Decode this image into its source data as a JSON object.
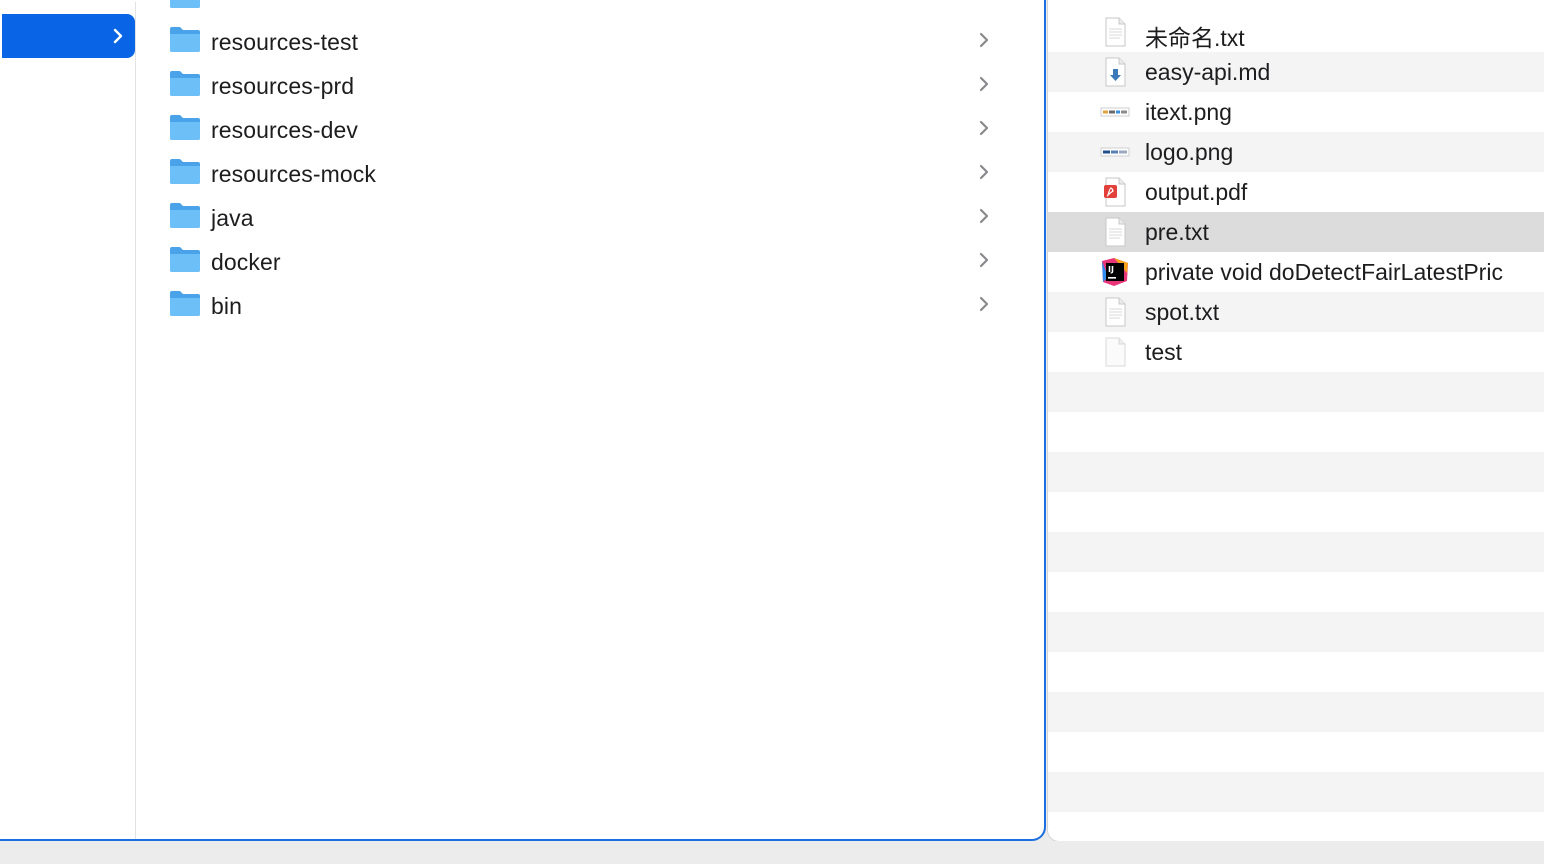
{
  "sidebar": {
    "selected_color": "#0a64e6"
  },
  "folders": [
    {
      "label": "resources-test"
    },
    {
      "label": "resources-prd"
    },
    {
      "label": "resources-dev"
    },
    {
      "label": "resources-mock"
    },
    {
      "label": "java"
    },
    {
      "label": "docker"
    },
    {
      "label": "bin"
    }
  ],
  "files": [
    {
      "name": "未命名.txt",
      "icon": "text-file-icon"
    },
    {
      "name": "easy-api.md",
      "icon": "markdown-file-icon"
    },
    {
      "name": "itext.png",
      "icon": "png-image-icon"
    },
    {
      "name": "logo.png",
      "icon": "png-image-icon"
    },
    {
      "name": "output.pdf",
      "icon": "pdf-file-icon"
    },
    {
      "name": "pre.txt",
      "icon": "text-file-icon",
      "selected": true
    },
    {
      "name": "private void doDetectFairLatestPric",
      "icon": "intellij-file-icon"
    },
    {
      "name": "spot.txt",
      "icon": "text-file-icon"
    },
    {
      "name": "test",
      "icon": "blank-file-icon"
    }
  ],
  "colors": {
    "accent": "#0a64e6",
    "folder": "#62b8f5",
    "selected_row": "#dcdcdc",
    "stripe": "#f4f4f5"
  }
}
